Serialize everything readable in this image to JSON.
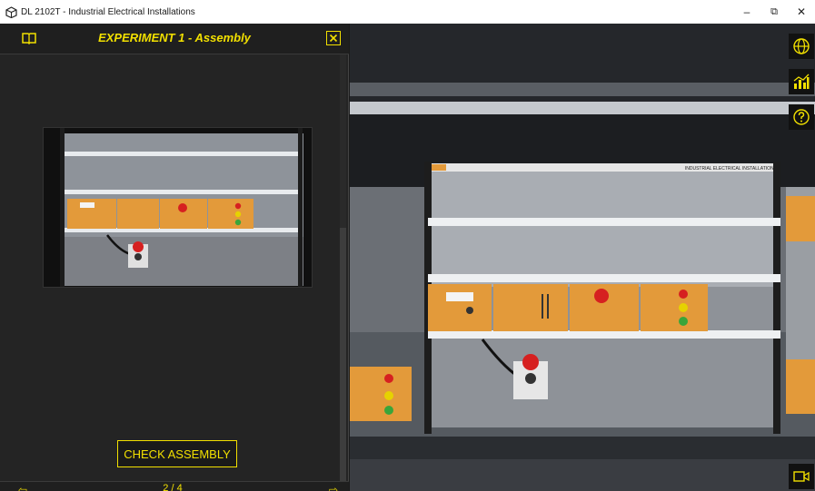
{
  "window": {
    "title": "DL 2102T - Industrial Electrical Installations",
    "minimize_glyph": "–",
    "restore_glyph": "⧉",
    "close_glyph": "✕"
  },
  "panel": {
    "title": "EXPERIMENT 1 - Assembly",
    "check_button_label": "CHECK ASSEMBLY",
    "page_indicator": "2 / 4"
  },
  "scene": {
    "rack_header_label": "INDUSTRIAL ELECTRICAL INSTALLATIONS"
  },
  "toolbar": {
    "icons": [
      "globe-icon",
      "chart-icon",
      "help-icon",
      "camera-icon"
    ]
  },
  "colors": {
    "accent": "#f2e000",
    "panel_bg": "#242424",
    "module_orange": "#e39a3a",
    "module_red": "#d62020",
    "module_yellow": "#e6d200",
    "module_green": "#3aa53a"
  }
}
